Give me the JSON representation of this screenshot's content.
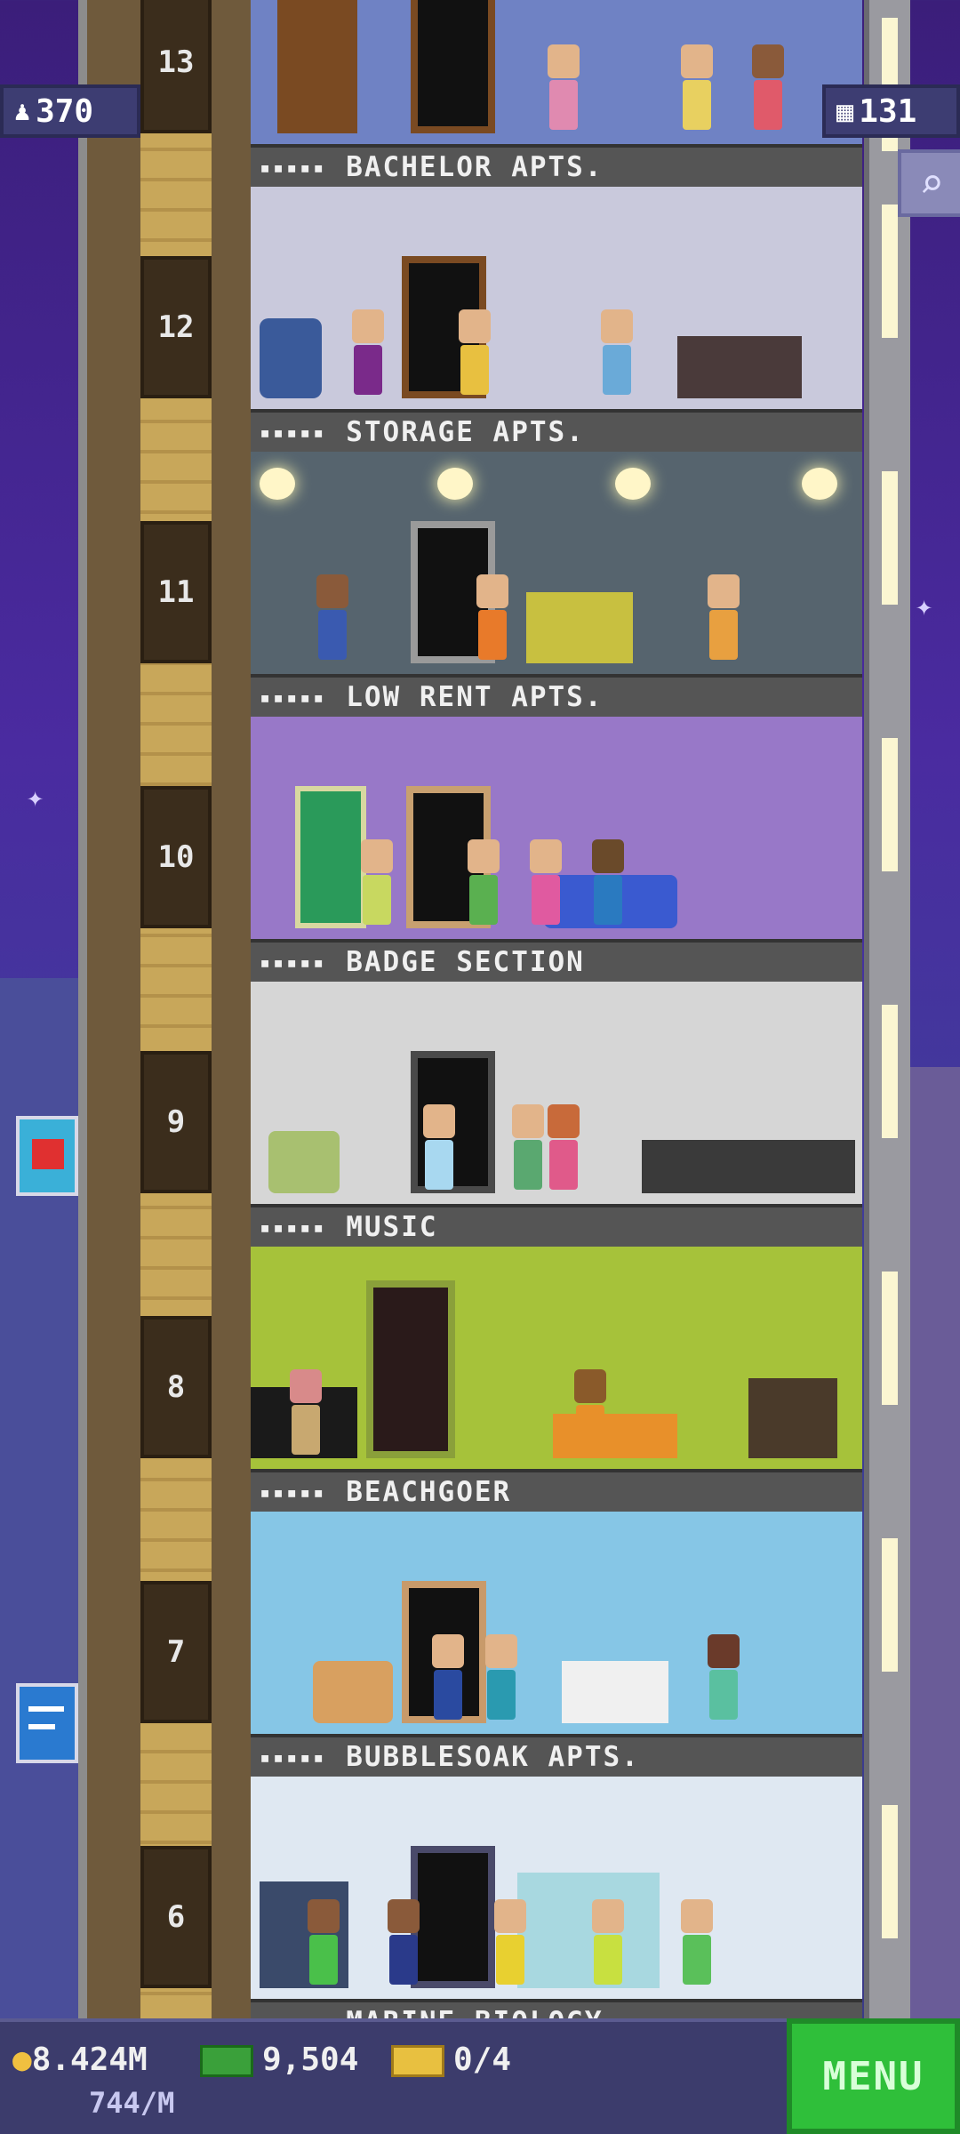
{
  "header": {
    "population": "370",
    "floor_count": "131"
  },
  "floors": [
    {
      "number": "13",
      "label": "BACHELOR APTS.",
      "stars": "▪▪▪▪▪",
      "wall": "#6f82c4",
      "floorc": "#7a4a22"
    },
    {
      "number": "12",
      "label": "STORAGE APTS.",
      "stars": "▪▪▪▪▪",
      "wall": "#c9c9dc",
      "floorc": "#7a4a22"
    },
    {
      "number": "11",
      "label": "LOW RENT APTS.",
      "stars": "▪▪▪▪▪",
      "wall": "#56646e",
      "floorc": "#6a4a3a"
    },
    {
      "number": "10",
      "label": "BADGE SECTION",
      "stars": "▪▪▪▪▪",
      "wall": "#9878c8",
      "floorc": "#3a7a3a"
    },
    {
      "number": "9",
      "label": "MUSIC",
      "stars": "▪▪▪▪▪",
      "wall": "#d6d6d6",
      "floorc": "#6a6a6a"
    },
    {
      "number": "8",
      "label": "BEACHGOER",
      "stars": "▪▪▪▪▪",
      "wall": "#a6c23a",
      "floorc": "#3aa03a"
    },
    {
      "number": "7",
      "label": "BUBBLESOAK APTS.",
      "stars": "▪▪▪▪▪",
      "wall": "#86c6e6",
      "floorc": "#8a5a3a"
    },
    {
      "number": "6",
      "label": "MARINE BIOLOGY",
      "stars": "▪▪▪▪▪",
      "wall": "#dfe8f2",
      "floorc": "#5a5a8a"
    }
  ],
  "bottom_bar": {
    "coins": "8.424M",
    "coins_rate": "744/M",
    "bux": "9,504",
    "tickets": "0/4",
    "menu_label": "MENU"
  },
  "icons": {
    "population": "person-icon",
    "floors": "building-icon",
    "search": "magnifier-icon",
    "coin": "coin-icon",
    "bux": "bux-icon",
    "ticket": "ticket-icon"
  }
}
